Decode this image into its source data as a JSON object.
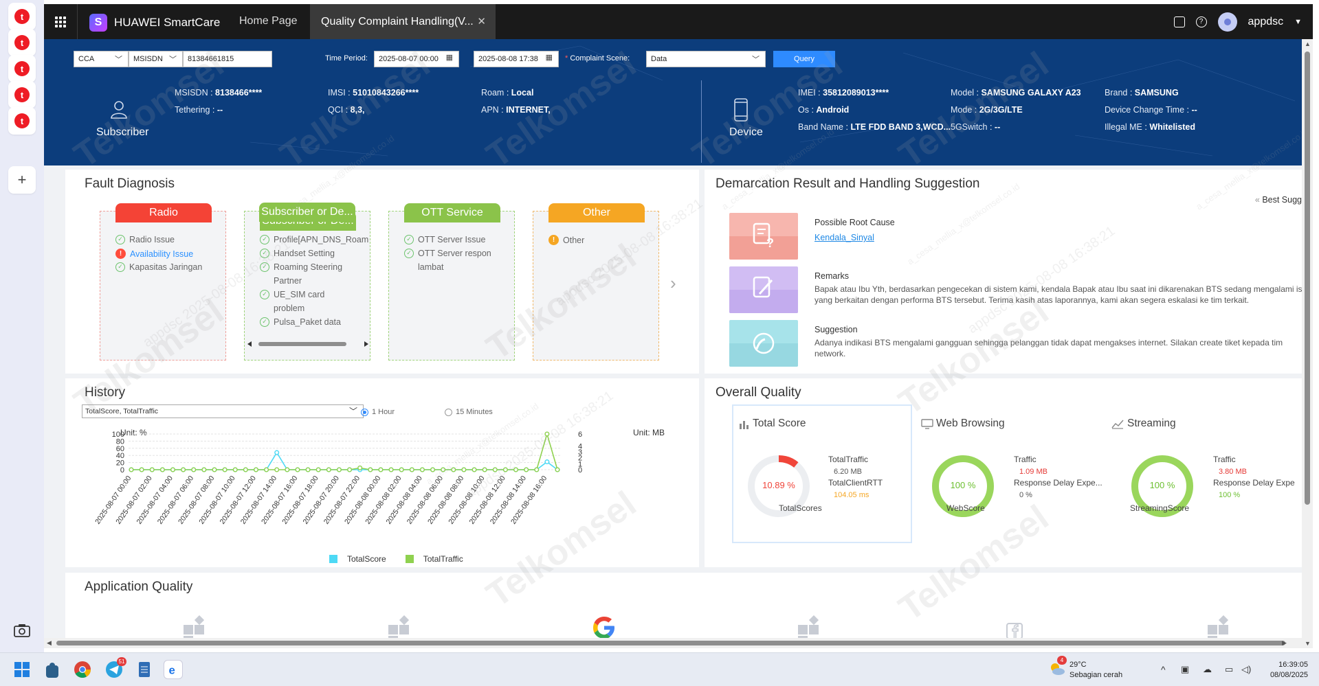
{
  "app": {
    "brand": "HUAWEI SmartCare",
    "home": "Home Page",
    "active_tab": "Quality Complaint Handling(V...",
    "user": "appdsc"
  },
  "query": {
    "scope": "CCA",
    "id_type": "MSISDN",
    "msisdn_value": "81384661815",
    "time_period_label": "Time Period:",
    "time_from": "2025-08-07 00:00",
    "time_to": "2025-08-08 17:38",
    "scene_label": "Complaint Scene:",
    "scene_value": "Data",
    "query_button": "Query"
  },
  "subscriber": {
    "label": "Subscriber",
    "fields": [
      {
        "key": "MSISDN",
        "value": "8138466****"
      },
      {
        "key": "IMSI",
        "value": "51010843266****"
      },
      {
        "key": "Roam",
        "value": "Local"
      },
      {
        "key": "Tethering",
        "value": "--"
      },
      {
        "key": "QCI",
        "value": "8,3,"
      },
      {
        "key": "APN",
        "value": "INTERNET,"
      }
    ]
  },
  "device": {
    "label": "Device",
    "fields": [
      {
        "key": "IMEI",
        "value": "35812089013****"
      },
      {
        "key": "Model",
        "value": "SAMSUNG GALAXY A23"
      },
      {
        "key": "Brand",
        "value": "SAMSUNG"
      },
      {
        "key": "Os",
        "value": "Android"
      },
      {
        "key": "Mode",
        "value": "2G/3G/LTE"
      },
      {
        "key": "Device Change Time",
        "value": "--"
      },
      {
        "key": "Band Name",
        "value": "LTE FDD BAND 3,WCD..."
      },
      {
        "key": "5GSwitch",
        "value": "--"
      },
      {
        "key": "Illegal ME",
        "value": "Whitelisted"
      }
    ]
  },
  "fault": {
    "title": "Fault Diagnosis",
    "cards": [
      {
        "name": "Radio",
        "color": "#f44336",
        "items": [
          "Radio Issue",
          "Availability Issue",
          "Kapasitas Jaringan"
        ]
      },
      {
        "name": "Subscriber or De...",
        "color": "#8bc34a",
        "items": [
          "Profile[APN_DNS_Roam",
          "Handset Setting",
          "Roaming Steering",
          "Partner",
          "UE_SIM card",
          "problem",
          "Pulsa_Paket data"
        ]
      },
      {
        "name": "OTT Service",
        "color": "#8bc34a",
        "items": [
          "OTT Server Issue",
          "OTT Server respon",
          "lambat"
        ]
      },
      {
        "name": "Other",
        "color": "#f5a623",
        "items": [
          "Other"
        ]
      }
    ]
  },
  "demarcation": {
    "title": "Demarcation Result and Handling Suggestion",
    "best": "Best Sugg",
    "root_cause_label": "Possible Root Cause",
    "root_cause_value": "Kendala_Sinyal",
    "remarks_label": "Remarks",
    "remarks_text": "Bapak atau Ibu Yth, berdasarkan pengecekan di sistem kami, kendala Bapak atau Ibu saat ini dikarenakan BTS sedang mengalami isu yang berkaitan dengan performa BTS tersebut. Terima kasih atas laporannya, kami akan segera eskalasi ke tim terkait.",
    "suggestion_label": "Suggestion",
    "suggestion_text": "Adanya indikasi BTS mengalami gangguan sehingga pelanggan tidak dapat mengakses internet. Silakan create tiket kepada tim network."
  },
  "history": {
    "title": "History",
    "selector": "TotalScore, TotalTraffic",
    "opt_1h": "1 Hour",
    "opt_15m": "15 Minutes",
    "unit_left": "Unit: %",
    "unit_right": "Unit: MB",
    "legend_score": "TotalScore",
    "legend_traffic": "TotalTraffic"
  },
  "chart_data": {
    "type": "line",
    "x": [
      "2025-08-07 00:00",
      "2025-08-07 01:00",
      "2025-08-07 02:00",
      "2025-08-07 03:00",
      "2025-08-07 04:00",
      "2025-08-07 05:00",
      "2025-08-07 06:00",
      "2025-08-07 07:00",
      "2025-08-07 08:00",
      "2025-08-07 09:00",
      "2025-08-07 10:00",
      "2025-08-07 11:00",
      "2025-08-07 12:00",
      "2025-08-07 13:00",
      "2025-08-07 14:00",
      "2025-08-07 15:00",
      "2025-08-07 16:00",
      "2025-08-07 17:00",
      "2025-08-07 18:00",
      "2025-08-07 19:00",
      "2025-08-07 20:00",
      "2025-08-07 21:00",
      "2025-08-07 22:00",
      "2025-08-07 23:00",
      "2025-08-08 00:00",
      "2025-08-08 01:00",
      "2025-08-08 02:00",
      "2025-08-08 03:00",
      "2025-08-08 04:00",
      "2025-08-08 05:00",
      "2025-08-08 06:00",
      "2025-08-08 07:00",
      "2025-08-08 08:00",
      "2025-08-08 09:00",
      "2025-08-08 10:00",
      "2025-08-08 11:00",
      "2025-08-08 12:00",
      "2025-08-08 13:00",
      "2025-08-08 14:00",
      "2025-08-08 15:00",
      "2025-08-08 16:00",
      "2025-08-08 17:00"
    ],
    "tick_labels": [
      "2025-08-07 00:00",
      "2025-08-07 02:00",
      "2025-08-07 04:00",
      "2025-08-07 06:00",
      "2025-08-07 08:00",
      "2025-08-07 10:00",
      "2025-08-07 12:00",
      "2025-08-07 14:00",
      "2025-08-07 16:00",
      "2025-08-07 18:00",
      "2025-08-07 20:00",
      "2025-08-07 22:00",
      "2025-08-08 00:00",
      "2025-08-08 02:00",
      "2025-08-08 04:00",
      "2025-08-08 06:00",
      "2025-08-08 08:00",
      "2025-08-08 10:00",
      "2025-08-08 12:00",
      "2025-08-08 14:00",
      "2025-08-08 16:00"
    ],
    "series": [
      {
        "name": "TotalScore",
        "color": "#4dd9f5",
        "axis": "left",
        "values": [
          0,
          0,
          0,
          0,
          0,
          0,
          0,
          0,
          0,
          0,
          0,
          0,
          0,
          0,
          0,
          0,
          0,
          0,
          0,
          0,
          0,
          0,
          0,
          0,
          0,
          0,
          0,
          0,
          0,
          0,
          0,
          0,
          0,
          0,
          0,
          0,
          0,
          0,
          0,
          0,
          0,
          0
        ]
      },
      {
        "name": "TotalTraffic",
        "color": "#8fd14f",
        "axis": "right",
        "values": [
          0,
          0,
          0,
          0,
          0,
          0,
          0,
          0,
          0,
          0,
          0,
          0,
          0,
          0,
          0,
          0,
          0,
          0,
          0,
          0,
          0,
          0,
          0,
          0,
          0,
          0,
          0,
          0,
          0,
          0,
          0,
          0,
          0,
          0,
          0,
          0,
          0,
          0,
          0,
          0,
          0,
          0
        ]
      }
    ],
    "score_points": [
      [
        14,
        48
      ],
      [
        40,
        22
      ]
    ],
    "traffic_points": [
      [
        22,
        0.3
      ],
      [
        40,
        6.0
      ]
    ],
    "ylim_left": [
      0,
      100
    ],
    "yticks_left": [
      0,
      20,
      40,
      60,
      80,
      100
    ],
    "ylim_right": [
      0,
      6
    ],
    "yticks_right": [
      0,
      1,
      2,
      3,
      4,
      6
    ]
  },
  "overall": {
    "title": "Overall Quality",
    "total": {
      "head": "Total Score",
      "score": "10.89 %",
      "score_pct": 10.89,
      "k1": "TotalTraffic",
      "v1": "6.20 MB",
      "k2": "TotalClientRTT",
      "v2": "104.05 ms",
      "label": "TotalScores"
    },
    "web": {
      "head": "Web Browsing",
      "score": "100 %",
      "score_pct": 100,
      "k1": "Traffic",
      "v1": "1.09 MB",
      "k2": "Response Delay Expe...",
      "v2": "0 %",
      "label": "WebScore"
    },
    "stream": {
      "head": "Streaming",
      "score": "100 %",
      "score_pct": 100,
      "k1": "Traffic",
      "v1": "3.80 MB",
      "k2": "Response Delay Expe",
      "v2": "100 %",
      "label": "StreamingScore"
    }
  },
  "appq": {
    "title": "Application Quality"
  },
  "watermark": {
    "brand": "Telkomsel",
    "user_stamp": "appdsc 2025-08-08 16:38:21",
    "email_stamp": "a_cesa_mellia_x@telkomsel.co.id"
  },
  "taskbar": {
    "temp": "29°C",
    "weather": "Sebagian cerah",
    "weather_badge": "4",
    "telegram_badge": "51",
    "time": "16:39:05",
    "date": "08/08/2025"
  },
  "colors": {
    "header_blue": "#0c3d7c",
    "query_blue": "#2e8bff",
    "red": "#f44336",
    "green": "#8bc34a",
    "orange": "#f5a623"
  }
}
